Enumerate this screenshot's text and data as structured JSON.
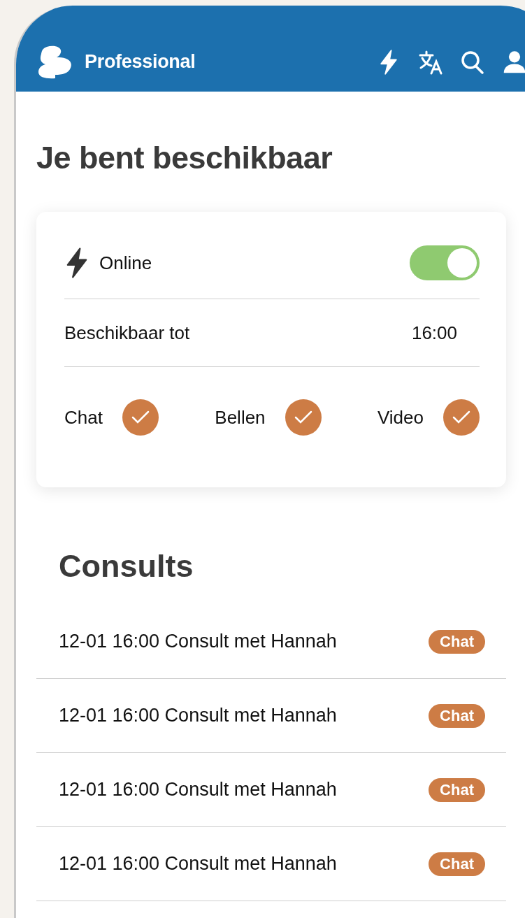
{
  "header": {
    "brand": "Professional"
  },
  "title": "Je bent beschikbaar",
  "availability": {
    "online": {
      "label": "Online",
      "on": true
    },
    "until": {
      "label": "Beschikbaar tot",
      "value": "16:00"
    },
    "channels": [
      {
        "label": "Chat",
        "checked": true
      },
      {
        "label": "Bellen",
        "checked": true
      },
      {
        "label": "Video",
        "checked": true
      }
    ]
  },
  "consults": {
    "title": "Consults",
    "items": [
      {
        "text": "12-01 16:00 Consult met Hannah",
        "badge": "Chat"
      },
      {
        "text": "12-01 16:00 Consult met Hannah",
        "badge": "Chat"
      },
      {
        "text": "12-01 16:00 Consult met Hannah",
        "badge": "Chat"
      },
      {
        "text": "12-01 16:00 Consult met Hannah",
        "badge": "Chat"
      }
    ]
  }
}
